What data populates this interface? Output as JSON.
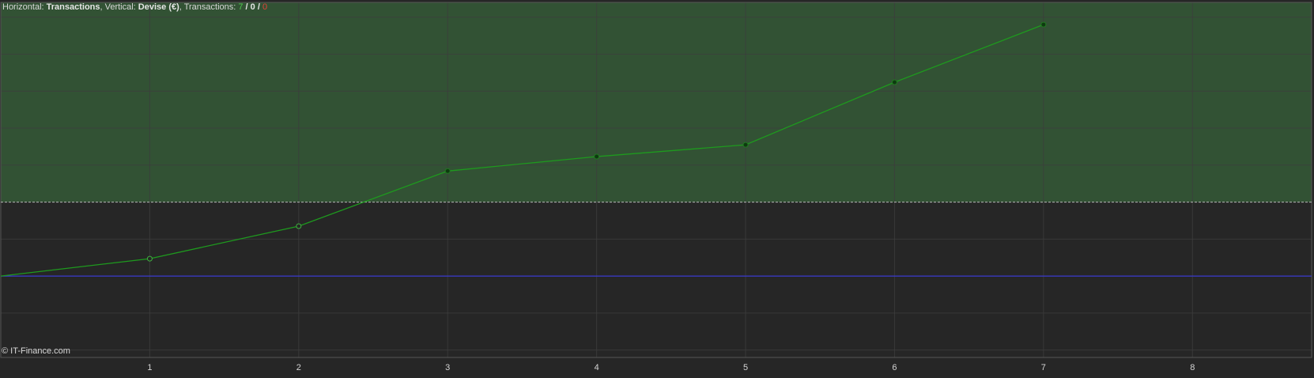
{
  "header": {
    "horizontal_label": "Horizontal: ",
    "horizontal_value": "Transactions",
    "vertical_label": ", Vertical: ",
    "vertical_value": "Devise (€)",
    "transactions_label": ", Transactions: ",
    "count_win": "7",
    "sep1": " / ",
    "count_neutral": "0",
    "sep2": " / ",
    "count_loss": "0"
  },
  "watermark": "© IT-Finance.com",
  "colors": {
    "background": "#262626",
    "profit_zone": "#325234",
    "line": "#1e9a1e",
    "baseline": "#3a3acf",
    "grid": "#3d3d3d",
    "threshold": "#b5b5b5"
  },
  "chart_data": {
    "type": "line",
    "title": "",
    "xlabel": "Transactions",
    "ylabel": "Devise (€)",
    "x_ticks": [
      1,
      2,
      3,
      4,
      5,
      6,
      7,
      8
    ],
    "xlim": [
      0,
      8.8
    ],
    "ylim": [
      -2.2,
      7.4
    ],
    "baseline_y": 0,
    "threshold_y": 2.0,
    "y_grid_step": 1,
    "grid": true,
    "series": [
      {
        "x": [
          0,
          1,
          2,
          3,
          4,
          5,
          6,
          7
        ],
        "values": [
          0,
          0.47,
          1.35,
          2.84,
          3.23,
          3.55,
          5.24,
          6.8
        ],
        "marker_style": [
          "none",
          "hollow",
          "hollow",
          "filled",
          "filled",
          "filled",
          "filled",
          "filled"
        ]
      }
    ]
  }
}
